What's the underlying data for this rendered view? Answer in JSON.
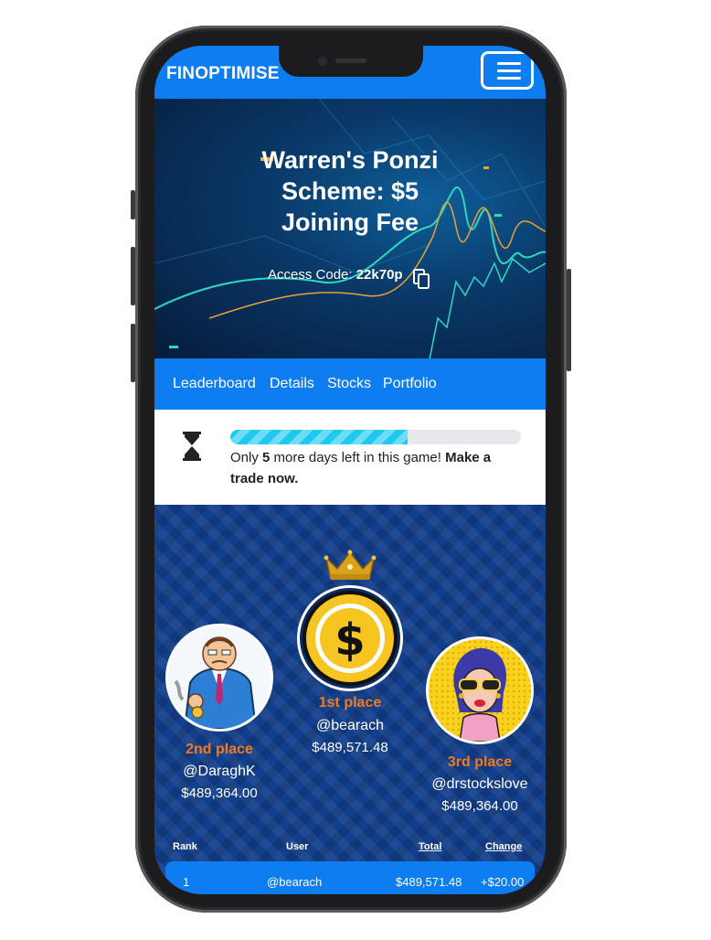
{
  "brand": "FINOPTIMISE",
  "hero": {
    "title": "Warren's Ponzi Scheme: $5 Joining Fee",
    "access_label": "Access Code: ",
    "access_code": "22k70p"
  },
  "tabs": [
    "Leaderboard",
    "Details",
    "Stocks",
    "Portfolio"
  ],
  "notice": {
    "progress_fraction": 0.61,
    "text_pre": "Only ",
    "days": "5",
    "text_mid": " more days left in this game! ",
    "cta": "Make a trade now."
  },
  "podium": {
    "first": {
      "place": "1st place",
      "user": "@bearach",
      "amount": "$489,571.48"
    },
    "second": {
      "place": "2nd place",
      "user": "@DaraghK",
      "amount": "$489,364.00"
    },
    "third": {
      "place": "3rd place",
      "user": "@drstockslove",
      "amount": "$489,364.00"
    }
  },
  "table": {
    "headers": {
      "rank": "Rank",
      "user": "User",
      "total": "Total",
      "change": "Change"
    },
    "rows": [
      {
        "rank": "1",
        "user": "@bearach",
        "total": "$489,571.48",
        "change": "+$20.00"
      }
    ]
  },
  "colors": {
    "accent_blue": "#0d7df0",
    "place_orange": "#f07a1c",
    "progress_cyan": "#1ec8ef"
  }
}
